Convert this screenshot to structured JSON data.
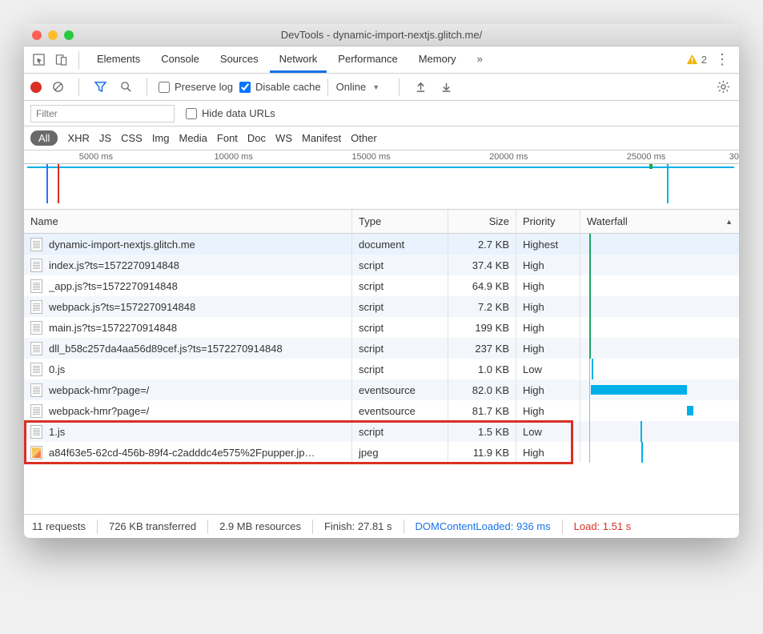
{
  "window": {
    "title": "DevTools - dynamic-import-nextjs.glitch.me/"
  },
  "tabs": {
    "items": [
      "Elements",
      "Console",
      "Sources",
      "Network",
      "Performance",
      "Memory"
    ],
    "active": "Network",
    "more": "»",
    "warning_count": "2"
  },
  "toolbar": {
    "preserve_log": "Preserve log",
    "disable_cache": "Disable cache",
    "throttling": "Online"
  },
  "filter": {
    "placeholder": "Filter",
    "hide_data_urls": "Hide data URLs"
  },
  "types": [
    "All",
    "XHR",
    "JS",
    "CSS",
    "Img",
    "Media",
    "Font",
    "Doc",
    "WS",
    "Manifest",
    "Other"
  ],
  "timeline_ticks": [
    "5000 ms",
    "10000 ms",
    "15000 ms",
    "20000 ms",
    "25000 ms",
    "30"
  ],
  "columns": {
    "name": "Name",
    "type": "Type",
    "size": "Size",
    "priority": "Priority",
    "waterfall": "Waterfall"
  },
  "rows": [
    {
      "icon": "doc",
      "name": "dynamic-import-nextjs.glitch.me",
      "type": "document",
      "size": "2.7 KB",
      "priority": "Highest",
      "wf": {
        "l": 0,
        "w": 0,
        "color": "green",
        "tick": 1
      }
    },
    {
      "icon": "doc",
      "name": "index.js?ts=1572270914848",
      "type": "script",
      "size": "37.4 KB",
      "priority": "High",
      "wf": {
        "l": 0,
        "w": 0,
        "color": "green",
        "tick": 1
      }
    },
    {
      "icon": "doc",
      "name": "_app.js?ts=1572270914848",
      "type": "script",
      "size": "64.9 KB",
      "priority": "High",
      "wf": {
        "l": 0,
        "w": 0,
        "color": "green",
        "tick": 1
      }
    },
    {
      "icon": "doc",
      "name": "webpack.js?ts=1572270914848",
      "type": "script",
      "size": "7.2 KB",
      "priority": "High",
      "wf": {
        "l": 0,
        "w": 0,
        "color": "green",
        "tick": 1
      }
    },
    {
      "icon": "doc",
      "name": "main.js?ts=1572270914848",
      "type": "script",
      "size": "199 KB",
      "priority": "High",
      "wf": {
        "l": 0,
        "w": 0,
        "color": "green",
        "tick": 1
      }
    },
    {
      "icon": "doc",
      "name": "dll_b58c257da4aa56d89cef.js?ts=1572270914848",
      "type": "script",
      "size": "237 KB",
      "priority": "High",
      "wf": {
        "l": 0,
        "w": 0,
        "color": "green",
        "tick": 1
      }
    },
    {
      "icon": "doc",
      "name": "0.js",
      "type": "script",
      "size": "1.0 KB",
      "priority": "Low",
      "wf": {
        "l": 3,
        "w": 0,
        "tick": 1
      }
    },
    {
      "icon": "doc",
      "name": "webpack-hmr?page=/",
      "type": "eventsource",
      "size": "82.0 KB",
      "priority": "High",
      "wf": {
        "l": 5,
        "w": 120,
        "color": "blue"
      }
    },
    {
      "icon": "doc",
      "name": "webpack-hmr?page=/",
      "type": "eventsource",
      "size": "81.7 KB",
      "priority": "High",
      "wf": {
        "l": 125,
        "w": 8,
        "color": "blue"
      }
    },
    {
      "icon": "doc",
      "name": "1.js",
      "type": "script",
      "size": "1.5 KB",
      "priority": "Low",
      "wf": {
        "l": 64,
        "w": 0,
        "tick": 1
      }
    },
    {
      "icon": "img",
      "name": "a84f63e5-62cd-456b-89f4-c2adddc4e575%2Fpupper.jp…",
      "type": "jpeg",
      "size": "11.9 KB",
      "priority": "High",
      "wf": {
        "l": 65,
        "w": 0,
        "tick": 1
      }
    }
  ],
  "status": {
    "requests": "11 requests",
    "transferred": "726 KB transferred",
    "resources": "2.9 MB resources",
    "finish": "Finish: 27.81 s",
    "dcl": "DOMContentLoaded: 936 ms",
    "load": "Load: 1.51 s"
  }
}
